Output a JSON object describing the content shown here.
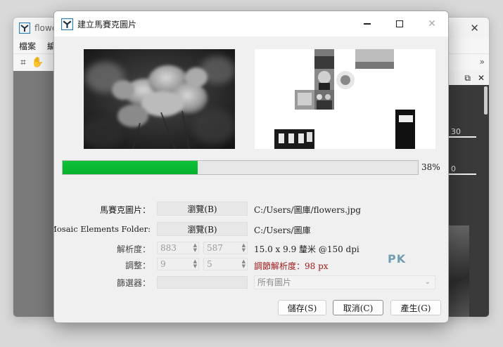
{
  "background_window": {
    "title": "flowe",
    "menu": [
      "檔案",
      "編"
    ],
    "more_glyph": "»",
    "panel_fields": [
      "30",
      "0"
    ]
  },
  "dialog": {
    "title": "建立馬賽克圖片",
    "progress": {
      "percent": 38,
      "label": "38%"
    },
    "rows": {
      "mosaic_image": {
        "label": "馬賽克圖片：",
        "button": "瀏覽(B)",
        "value": "C:/Users/圖庫/flowers.jpg"
      },
      "elements_folder": {
        "label": "Mosaic Elements Folder:",
        "button": "瀏覽(B)",
        "value": "C:/Users/圖庫"
      },
      "resolution": {
        "label": "解析度：",
        "width": "883",
        "height": "587",
        "value": "15.0 x 9.9 釐米 @150 dpi"
      },
      "adjust": {
        "label": "調整：",
        "cols": "9",
        "rows": "5",
        "value": "調節解析度：98 px"
      },
      "filter": {
        "label": "篩選器：",
        "select_value": "所有圖片"
      }
    },
    "buttons": {
      "save": "儲存(S)",
      "cancel": "取消(C)",
      "generate": "產生(G)"
    },
    "watermark": "PK"
  },
  "colors": {
    "progress_fill": "#0bbb33",
    "adjust_text": "#a01818"
  }
}
